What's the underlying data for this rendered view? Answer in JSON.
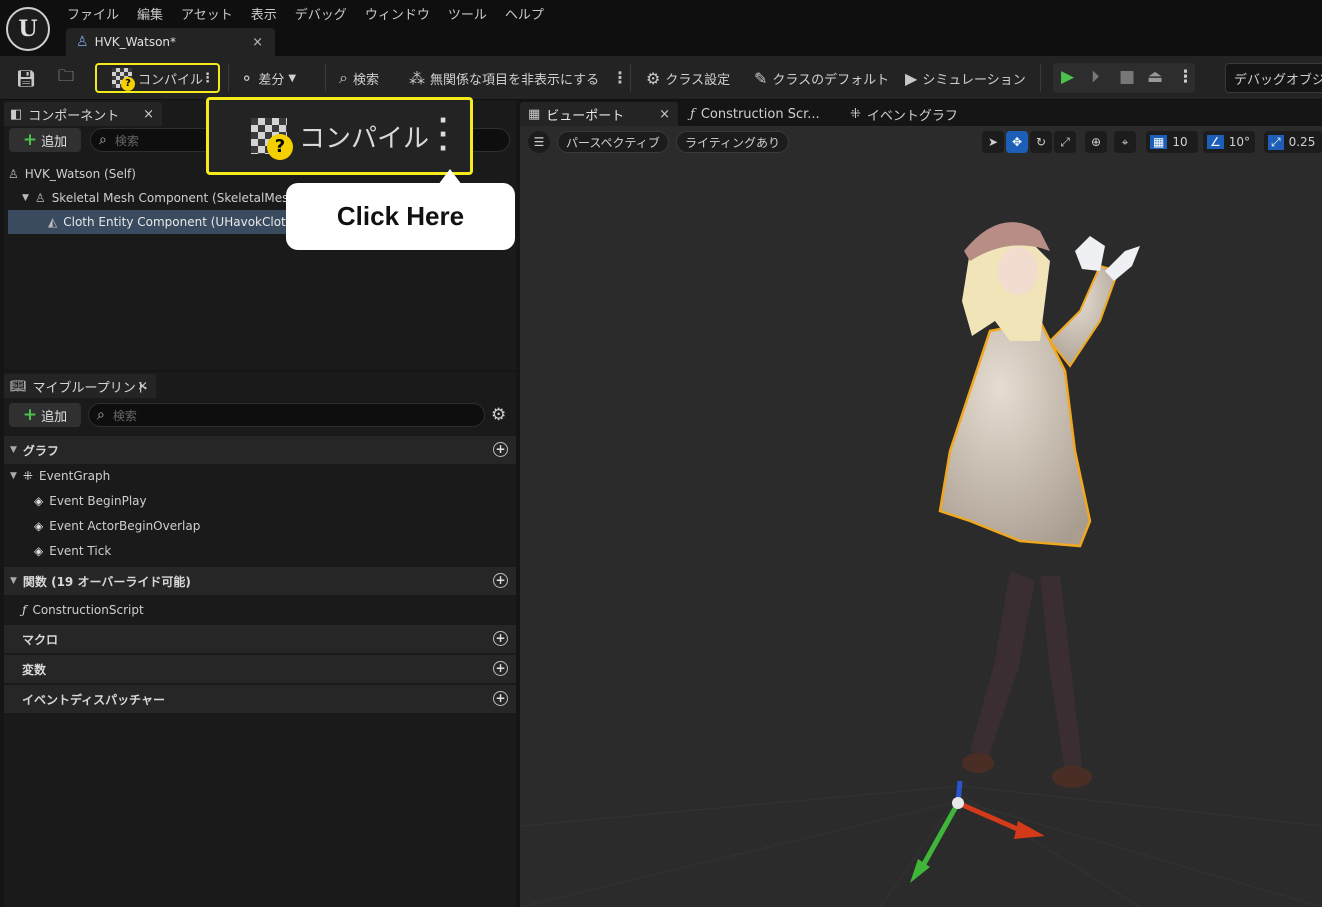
{
  "app": {
    "logo": "ue-logo",
    "logo_glyph": "U"
  },
  "menu": [
    "ファイル",
    "編集",
    "アセット",
    "表示",
    "デバッグ",
    "ウィンドウ",
    "ツール",
    "ヘルプ"
  ],
  "document_tab": {
    "label": "HVK_Watson*",
    "close": "×"
  },
  "toolbar": {
    "compile": "コンパイル",
    "diff": "差分",
    "search": "検索",
    "hide_unrelated": "無関係な項目を非表示にする",
    "class_settings": "クラス設定",
    "class_defaults": "クラスのデフォルト",
    "simulation": "シミュレーション",
    "debug_object": "デバッグオブジェ"
  },
  "components": {
    "tab_label": "コンポーネント",
    "close": "×",
    "add_label": "追加",
    "search_placeholder": "検索",
    "tree": [
      {
        "label": "HVK_Watson (Self)",
        "icon": "person-icon"
      },
      {
        "label": "Skeletal Mesh Component (SkeletalMes",
        "icon": "skeletal-mesh-icon"
      },
      {
        "label": "Cloth Entity Component (UHavokCloth",
        "icon": "cloth-icon",
        "selected": true
      }
    ]
  },
  "my_blueprint": {
    "tab_label": "マイブループリント",
    "close": "×",
    "add_label": "追加",
    "search_placeholder": "検索",
    "graphs_header": "グラフ",
    "event_graph": "EventGraph",
    "events": [
      "Event BeginPlay",
      "Event ActorBeginOverlap",
      "Event Tick"
    ],
    "functions_header": "関数 (19 オーバーライド可能)",
    "construction_script": "ConstructionScript",
    "macros_header": "マクロ",
    "variables_header": "変数",
    "dispatchers_header": "イベントディスパッチャー"
  },
  "viewport": {
    "tabs": [
      {
        "label": "ビューポート",
        "icon": "viewport-icon",
        "close": "×"
      },
      {
        "label": "Construction Scr...",
        "icon": "function-icon"
      },
      {
        "label": "イベントグラフ",
        "icon": "graph-icon"
      }
    ],
    "perspective": "パースペクティブ",
    "lighting": "ライティングあり",
    "grid_snap": "10",
    "rotation_snap": "10°",
    "scale_snap": "0.25"
  },
  "callout": {
    "label": "コンパイル",
    "bubble_text": "Click Here",
    "highlight_color": "#f4ea1c"
  }
}
